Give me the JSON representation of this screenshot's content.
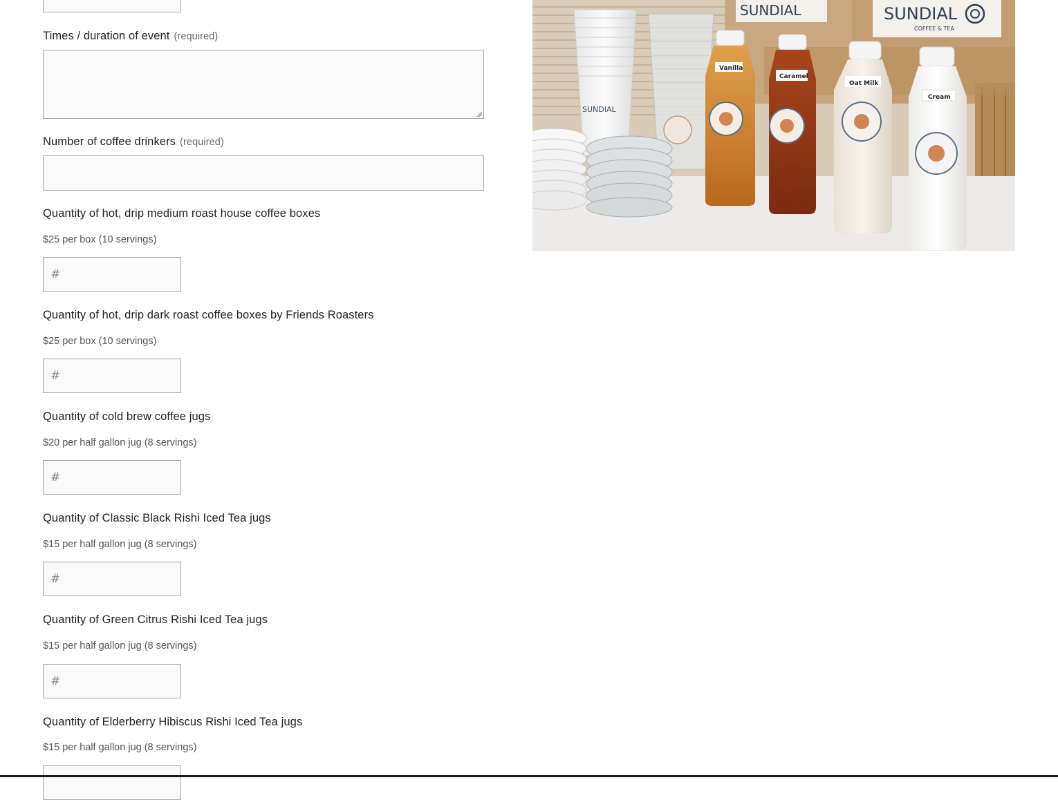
{
  "form": {
    "top_partial_placeholder": "",
    "times_field": {
      "label": "Times / duration of event",
      "required": "(required)"
    },
    "drinkers_field": {
      "label": "Number of coffee drinkers",
      "required": "(required)"
    },
    "quantity_fields": [
      {
        "label": "Quantity of hot, drip medium roast house coffee boxes",
        "price": "$25 per box (10 servings)",
        "placeholder": "#"
      },
      {
        "label": "Quantity of hot, drip dark roast coffee boxes by Friends Roasters",
        "price": "$25 per box (10 servings)",
        "placeholder": "#"
      },
      {
        "label": "Quantity of cold brew coffee jugs",
        "price": "$20 per half gallon jug (8 servings)",
        "placeholder": "#"
      },
      {
        "label": "Quantity of Classic Black Rishi Iced Tea jugs",
        "price": "$15 per half gallon jug (8 servings)",
        "placeholder": "#"
      },
      {
        "label": "Quantity of Green Citrus Rishi Iced Tea jugs",
        "price": "$15 per half gallon jug (8 servings)",
        "placeholder": "#"
      },
      {
        "label": "Quantity of Elderberry Hibiscus Rishi Iced Tea jugs",
        "price": "$15 per half gallon jug (8 servings)",
        "placeholder": "#"
      }
    ]
  },
  "photo": {
    "brand_left": "SUNDIAL",
    "brand_right": "SUNDIAL",
    "brand_sub": "COFFEE & TEA",
    "bottle_labels": [
      "Vanilla",
      "Caramel",
      "Oat Milk",
      "Cream"
    ],
    "cup_logo": "SUNDIAL"
  },
  "colors": {
    "border": "#a7a7a7",
    "field_bg": "#fafafa",
    "text": "#222222",
    "muted": "#555555"
  }
}
